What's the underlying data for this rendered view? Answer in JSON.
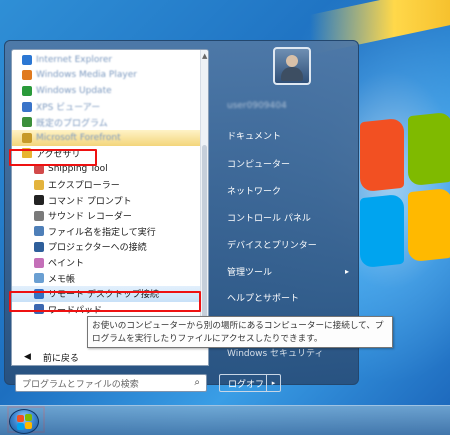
{
  "left_items": [
    {
      "label": "Internet Explorer",
      "blur": true,
      "color": "#2b77d3"
    },
    {
      "label": "Windows Media Player",
      "blur": true,
      "color": "#e07a1f"
    },
    {
      "label": "Windows Update",
      "blur": true,
      "color": "#2a9a3a"
    },
    {
      "label": "XPS ビューアー",
      "blur": true,
      "color": "#3a74c9"
    },
    {
      "label": "既定のプログラム",
      "blur": true,
      "color": "#3b8f3b"
    },
    {
      "label": "Microsoft Forefront",
      "blur": true,
      "color": "#c79a2a"
    },
    {
      "label": "アクセサリ",
      "blur": false,
      "color": "#e7b431",
      "folder": true
    },
    {
      "label": "Snipping Tool",
      "blur": false,
      "color": "#d24a4a",
      "sub": true
    },
    {
      "label": "エクスプローラー",
      "blur": false,
      "color": "#e3b33d",
      "sub": true
    },
    {
      "label": "コマンド プロンプト",
      "blur": false,
      "color": "#222222",
      "sub": true
    },
    {
      "label": "サウンド レコーダー",
      "blur": false,
      "color": "#7a7a7a",
      "sub": true
    },
    {
      "label": "ファイル名を指定して実行",
      "blur": false,
      "color": "#4e7fb8",
      "sub": true
    },
    {
      "label": "プロジェクターへの接続",
      "blur": false,
      "color": "#2f5f9b",
      "sub": true
    },
    {
      "label": "ペイント",
      "blur": false,
      "color": "#c46fb8",
      "sub": true
    },
    {
      "label": "メモ帳",
      "blur": false,
      "color": "#6a9fd2",
      "sub": true
    },
    {
      "label": "リモート デスクトップ接続",
      "blur": false,
      "color": "#3372c4",
      "sub": true
    },
    {
      "label": "ワードパッド",
      "blur": false,
      "color": "#3c67b0",
      "sub": true
    }
  ],
  "prev_label": "前に戻る",
  "prev_arrow": "◀",
  "search_placeholder": "プログラムとファイルの検索",
  "search_icon": "⌕",
  "scroll_up": "▲",
  "right": {
    "username": "user0909404",
    "items": [
      "ドキュメント",
      "コンピューター",
      "ネットワーク",
      "コントロール パネル",
      "デバイスとプリンター",
      "管理ツール",
      "ヘルプとサポート",
      "Windows セキュリティ"
    ],
    "submenu_arrow": "▸",
    "logoff": "ログオフ",
    "logoff_arrow": "▸"
  },
  "tooltip": "お使いのコンピューターから別の場所にあるコンピューターに接続して、プログラムを実行したりファイルにアクセスしたりできます。",
  "colors": {
    "highlight_box": "#e11111",
    "menu_base": "#2d5a8c"
  }
}
